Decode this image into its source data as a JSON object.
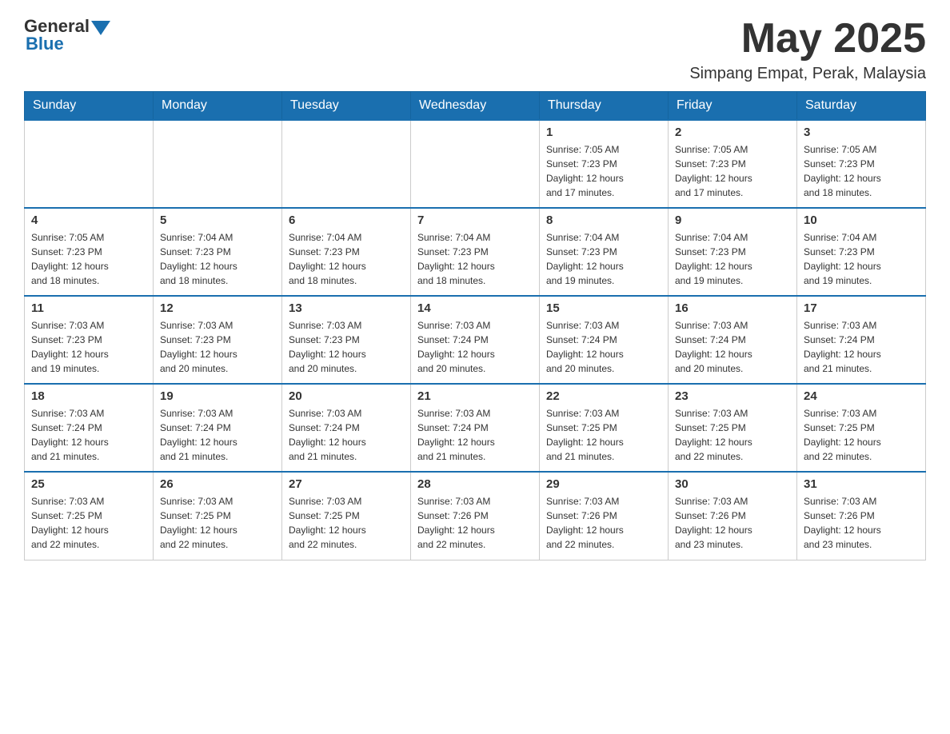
{
  "header": {
    "logo_general": "General",
    "logo_blue": "Blue",
    "month_title": "May 2025",
    "location": "Simpang Empat, Perak, Malaysia"
  },
  "weekdays": [
    "Sunday",
    "Monday",
    "Tuesday",
    "Wednesday",
    "Thursday",
    "Friday",
    "Saturday"
  ],
  "weeks": [
    [
      {
        "day": "",
        "info": ""
      },
      {
        "day": "",
        "info": ""
      },
      {
        "day": "",
        "info": ""
      },
      {
        "day": "",
        "info": ""
      },
      {
        "day": "1",
        "info": "Sunrise: 7:05 AM\nSunset: 7:23 PM\nDaylight: 12 hours\nand 17 minutes."
      },
      {
        "day": "2",
        "info": "Sunrise: 7:05 AM\nSunset: 7:23 PM\nDaylight: 12 hours\nand 17 minutes."
      },
      {
        "day": "3",
        "info": "Sunrise: 7:05 AM\nSunset: 7:23 PM\nDaylight: 12 hours\nand 18 minutes."
      }
    ],
    [
      {
        "day": "4",
        "info": "Sunrise: 7:05 AM\nSunset: 7:23 PM\nDaylight: 12 hours\nand 18 minutes."
      },
      {
        "day": "5",
        "info": "Sunrise: 7:04 AM\nSunset: 7:23 PM\nDaylight: 12 hours\nand 18 minutes."
      },
      {
        "day": "6",
        "info": "Sunrise: 7:04 AM\nSunset: 7:23 PM\nDaylight: 12 hours\nand 18 minutes."
      },
      {
        "day": "7",
        "info": "Sunrise: 7:04 AM\nSunset: 7:23 PM\nDaylight: 12 hours\nand 18 minutes."
      },
      {
        "day": "8",
        "info": "Sunrise: 7:04 AM\nSunset: 7:23 PM\nDaylight: 12 hours\nand 19 minutes."
      },
      {
        "day": "9",
        "info": "Sunrise: 7:04 AM\nSunset: 7:23 PM\nDaylight: 12 hours\nand 19 minutes."
      },
      {
        "day": "10",
        "info": "Sunrise: 7:04 AM\nSunset: 7:23 PM\nDaylight: 12 hours\nand 19 minutes."
      }
    ],
    [
      {
        "day": "11",
        "info": "Sunrise: 7:03 AM\nSunset: 7:23 PM\nDaylight: 12 hours\nand 19 minutes."
      },
      {
        "day": "12",
        "info": "Sunrise: 7:03 AM\nSunset: 7:23 PM\nDaylight: 12 hours\nand 20 minutes."
      },
      {
        "day": "13",
        "info": "Sunrise: 7:03 AM\nSunset: 7:23 PM\nDaylight: 12 hours\nand 20 minutes."
      },
      {
        "day": "14",
        "info": "Sunrise: 7:03 AM\nSunset: 7:24 PM\nDaylight: 12 hours\nand 20 minutes."
      },
      {
        "day": "15",
        "info": "Sunrise: 7:03 AM\nSunset: 7:24 PM\nDaylight: 12 hours\nand 20 minutes."
      },
      {
        "day": "16",
        "info": "Sunrise: 7:03 AM\nSunset: 7:24 PM\nDaylight: 12 hours\nand 20 minutes."
      },
      {
        "day": "17",
        "info": "Sunrise: 7:03 AM\nSunset: 7:24 PM\nDaylight: 12 hours\nand 21 minutes."
      }
    ],
    [
      {
        "day": "18",
        "info": "Sunrise: 7:03 AM\nSunset: 7:24 PM\nDaylight: 12 hours\nand 21 minutes."
      },
      {
        "day": "19",
        "info": "Sunrise: 7:03 AM\nSunset: 7:24 PM\nDaylight: 12 hours\nand 21 minutes."
      },
      {
        "day": "20",
        "info": "Sunrise: 7:03 AM\nSunset: 7:24 PM\nDaylight: 12 hours\nand 21 minutes."
      },
      {
        "day": "21",
        "info": "Sunrise: 7:03 AM\nSunset: 7:24 PM\nDaylight: 12 hours\nand 21 minutes."
      },
      {
        "day": "22",
        "info": "Sunrise: 7:03 AM\nSunset: 7:25 PM\nDaylight: 12 hours\nand 21 minutes."
      },
      {
        "day": "23",
        "info": "Sunrise: 7:03 AM\nSunset: 7:25 PM\nDaylight: 12 hours\nand 22 minutes."
      },
      {
        "day": "24",
        "info": "Sunrise: 7:03 AM\nSunset: 7:25 PM\nDaylight: 12 hours\nand 22 minutes."
      }
    ],
    [
      {
        "day": "25",
        "info": "Sunrise: 7:03 AM\nSunset: 7:25 PM\nDaylight: 12 hours\nand 22 minutes."
      },
      {
        "day": "26",
        "info": "Sunrise: 7:03 AM\nSunset: 7:25 PM\nDaylight: 12 hours\nand 22 minutes."
      },
      {
        "day": "27",
        "info": "Sunrise: 7:03 AM\nSunset: 7:25 PM\nDaylight: 12 hours\nand 22 minutes."
      },
      {
        "day": "28",
        "info": "Sunrise: 7:03 AM\nSunset: 7:26 PM\nDaylight: 12 hours\nand 22 minutes."
      },
      {
        "day": "29",
        "info": "Sunrise: 7:03 AM\nSunset: 7:26 PM\nDaylight: 12 hours\nand 22 minutes."
      },
      {
        "day": "30",
        "info": "Sunrise: 7:03 AM\nSunset: 7:26 PM\nDaylight: 12 hours\nand 23 minutes."
      },
      {
        "day": "31",
        "info": "Sunrise: 7:03 AM\nSunset: 7:26 PM\nDaylight: 12 hours\nand 23 minutes."
      }
    ]
  ],
  "colors": {
    "header_bg": "#1a6faf",
    "header_text": "#ffffff",
    "border": "#aaa",
    "blue_accent": "#1a6faf"
  }
}
